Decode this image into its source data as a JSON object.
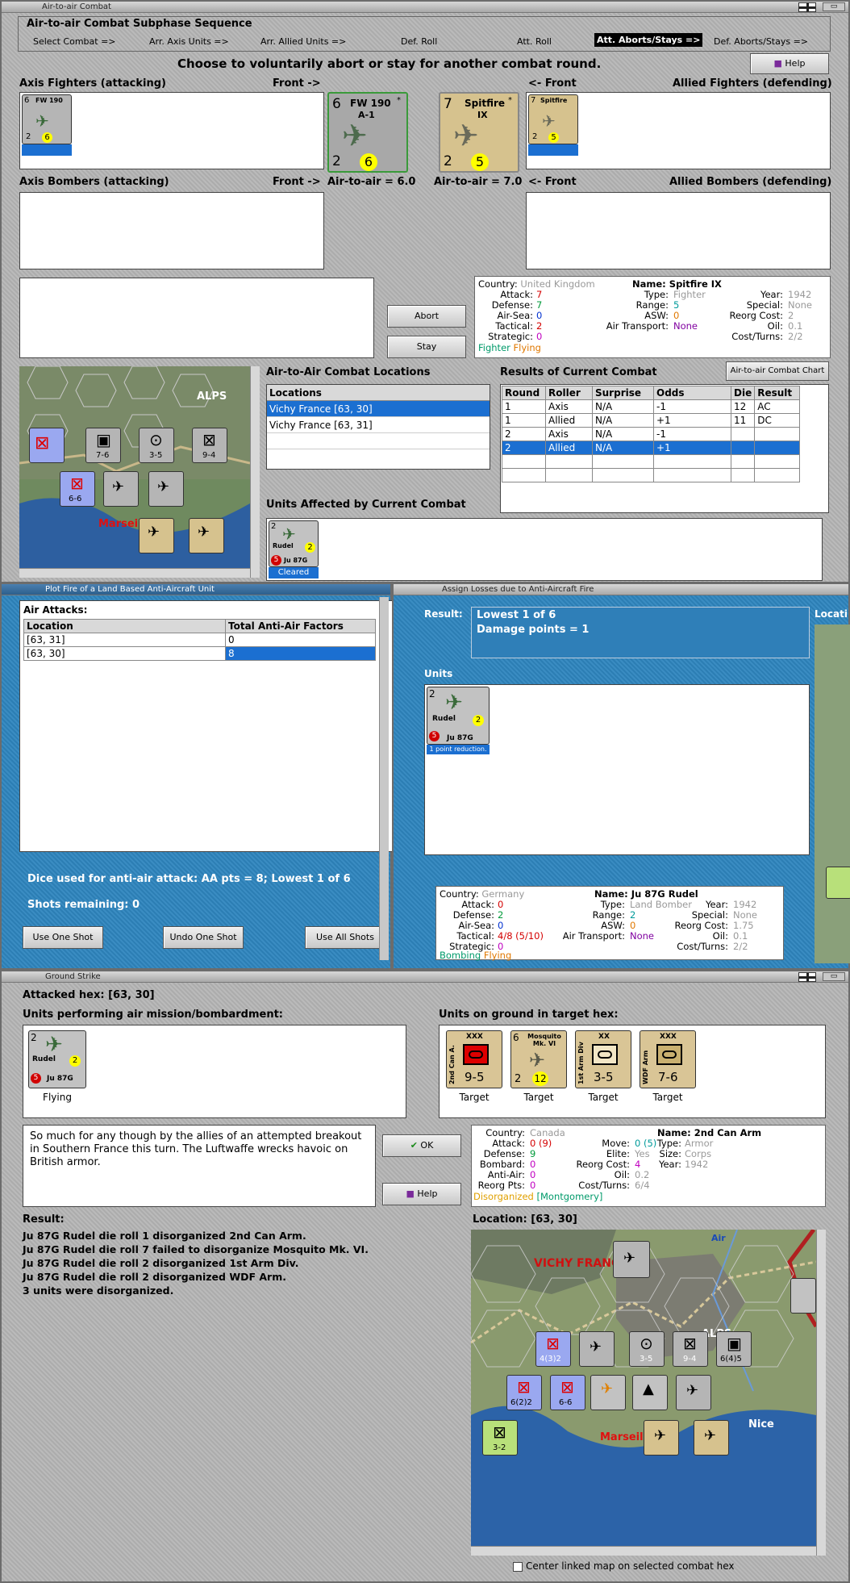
{
  "a2a": {
    "title": "Air-to-air Combat",
    "subphase_title": "Air-to-air Combat Subphase Sequence",
    "phases": [
      "Select Combat =>",
      "Arr. Axis Units =>",
      "Arr. Allied Units =>",
      "Def. Roll",
      "Att. Roll",
      "Att. Aborts/Stays =>",
      "Def. Aborts/Stays =>"
    ],
    "instruction": "Choose to voluntarily abort or stay for another combat round.",
    "help_label": "Help",
    "axis_fighters_label": "Axis Fighters (attacking)",
    "front_right": "Front ->",
    "front_left": "<- Front",
    "allied_fighters_label": "Allied Fighters (defending)",
    "axis_bombers_label": "Axis Bombers (attacking)",
    "allied_bombers_label": "Allied Bombers (defending)",
    "axis_a2a": "Air-to-air = 6.0",
    "allied_a2a": "Air-to-air = 7.0",
    "abort_label": "Abort",
    "stay_label": "Stay",
    "axis_unit": {
      "name": "FW 190",
      "sub": "A-1",
      "attack": "6",
      "def": "2",
      "move": "6",
      "star": "*"
    },
    "allied_unit": {
      "name": "Spitfire",
      "sub": "IX",
      "attack": "7",
      "def": "2",
      "move": "5",
      "star": "*"
    },
    "info": {
      "country_l": "Country:",
      "country": "United Kingdom",
      "attack_l": "Attack:",
      "attack": "7",
      "defense_l": "Defense:",
      "defense": "7",
      "airsea_l": "Air-Sea:",
      "airsea": "0",
      "tactical_l": "Tactical:",
      "tactical": "2",
      "strategic_l": "Strategic:",
      "strategic": "0",
      "status1": "Fighter",
      "status2": "Flying",
      "name_l": "Name:",
      "name": "Spitfire IX",
      "type_l": "Type:",
      "type": "Fighter",
      "range_l": "Range:",
      "range": "5",
      "asw_l": "ASW:",
      "asw": "0",
      "airtrans_l": "Air Transport:",
      "airtrans": "None",
      "year_l": "Year:",
      "year": "1942",
      "special_l": "Special:",
      "special": "None",
      "reorg_l": "Reorg Cost:",
      "reorg": "2",
      "oil_l": "Oil:",
      "oil": "0.1",
      "cost_l": "Cost/Turns:",
      "cost": "2/2"
    },
    "locations_title": "Air-to-Air Combat Locations",
    "locations_header": "Locations",
    "locations": [
      "Vichy France [63, 30]",
      "Vichy France [63, 31]"
    ],
    "results_title": "Results of Current Combat",
    "chart_btn": "Air-to-air Combat Chart",
    "results_headers": [
      "Round",
      "Roller",
      "Surprise",
      "Odds",
      "Die",
      "Result"
    ],
    "results": [
      [
        "1",
        "Axis",
        "N/A",
        "-1",
        "12",
        "AC"
      ],
      [
        "1",
        "Allied",
        "N/A",
        "+1",
        "11",
        "DC"
      ],
      [
        "2",
        "Axis",
        "N/A",
        "-1",
        "",
        ""
      ],
      [
        "2",
        "Allied",
        "N/A",
        "+1",
        "",
        ""
      ]
    ],
    "affected_title": "Units Affected by Current Combat",
    "affected_unit": {
      "name": "Rudel",
      "type": "Ju 87G",
      "status": "Cleared"
    },
    "map_labels": [
      "ALPS",
      "Marseil"
    ]
  },
  "aa": {
    "title": "Plot Fire of a Land Based Anti-Aircraft Unit",
    "air_attacks": "Air Attacks:",
    "headers": [
      "Location",
      "Total Anti-Air Factors"
    ],
    "rows": [
      [
        "[63, 31]",
        "0"
      ],
      [
        "[63, 30]",
        "8"
      ]
    ],
    "dice_text": "Dice used for anti-air attack:  AA pts = 8; Lowest 1 of 6",
    "shots_text": "Shots remaining:  0",
    "use_one": "Use One Shot",
    "undo_one": "Undo One Shot",
    "use_all": "Use All Shots"
  },
  "losses": {
    "title": "Assign Losses due to Anti-Aircraft Fire",
    "result_label": "Result:",
    "result_line1": "Lowest 1 of 6",
    "result_line2": "Damage points = 1",
    "units_label": "Units",
    "unit_caption": "1 point reduction.",
    "loc_cut": "Locati",
    "info": {
      "country_l": "Country:",
      "country": "Germany",
      "attack_l": "Attack:",
      "attack": "0",
      "defense_l": "Defense:",
      "defense": "2",
      "airsea_l": "Air-Sea:",
      "airsea": "0",
      "tactical_l": "Tactical:",
      "tactical": "4/8 (5/10)",
      "strategic_l": "Strategic:",
      "strategic": "0",
      "status1": "Bombing",
      "status2": "Flying",
      "name_l": "Name:",
      "name": "Ju 87G Rudel",
      "type_l": "Type:",
      "type": "Land Bomber",
      "range_l": "Range:",
      "range": "2",
      "asw_l": "ASW:",
      "asw": "0",
      "airtrans_l": "Air Transport:",
      "airtrans": "None",
      "year_l": "Year:",
      "year": "1942",
      "special_l": "Special:",
      "special": "None",
      "reorg_l": "Reorg Cost:",
      "reorg": "1.75",
      "oil_l": "Oil:",
      "oil": "0.1",
      "cost_l": "Cost/Turns:",
      "cost": "2/2"
    }
  },
  "ground": {
    "title": "Ground Strike",
    "attacked_hex": "Attacked hex:  [63, 30]",
    "performing_label": "Units performing air mission/bombardment:",
    "target_label": "Units on ground in target hex:",
    "flying_label": "Flying",
    "targets": [
      {
        "name": "2nd Can A.",
        "size": "XXX",
        "val": "9-5",
        "caption": "Target",
        "color": "#d9c596"
      },
      {
        "name": "Mosquito Mk. VI",
        "size": "",
        "val": "12",
        "caption": "Target",
        "color": "#d9c596"
      },
      {
        "name": "1st Arm Div",
        "size": "XX",
        "val": "3-5",
        "caption": "Target",
        "color": "#d9c596"
      },
      {
        "name": "WDF Arm",
        "size": "XXX",
        "val": "7-6",
        "caption": "Target",
        "color": "#d9c596"
      }
    ],
    "note": "So much for any though by the allies of an attempted breakout in Southern France this turn.  The Luftwaffe wrecks havoic on British armor.",
    "ok_label": "OK",
    "help_label": "Help",
    "info": {
      "country_l": "Country:",
      "country": "Canada",
      "attack_l": "Attack:",
      "attack": "0 (9)",
      "defense_l": "Defense:",
      "defense": "9",
      "bombard_l": "Bombard:",
      "bombard": "0",
      "antiair_l": "Anti-Air:",
      "antiair": "0",
      "reorgpts_l": "Reorg Pts:",
      "reorgpts": "0",
      "status1": "Disorganized",
      "status2": "[Montgomery]",
      "move_l": "Move:",
      "move": "0 (5)",
      "elite_l": "Elite:",
      "elite": "Yes",
      "reorg_l": "Reorg Cost:",
      "reorg": "4",
      "oil_l": "Oil:",
      "oil": "0.2",
      "cost_l": "Cost/Turns:",
      "cost": "6/4",
      "name_l": "Name:",
      "name": "2nd Can Arm",
      "type_l": "Type:",
      "type": "Armor",
      "size_l": "Size:",
      "size": "Corps",
      "year_l": "Year:",
      "year": "1942"
    },
    "result_label": "Result:",
    "results": [
      "Ju 87G Rudel die roll 1 disorganized 2nd Can Arm.",
      "Ju 87G Rudel die roll 7 failed to disorganize Mosquito Mk. VI.",
      "Ju 87G Rudel die roll 2 disorganized 1st Arm Div.",
      "Ju 87G Rudel die roll 2 disorganized WDF Arm.",
      "3 units were disorganized."
    ],
    "location_label": "Location:  [63, 30]",
    "center_label": "Center linked map on selected combat hex",
    "map_labels": [
      "VICHY FRANCE",
      "ALPS",
      "Marseil",
      "Nice",
      "Air"
    ]
  }
}
